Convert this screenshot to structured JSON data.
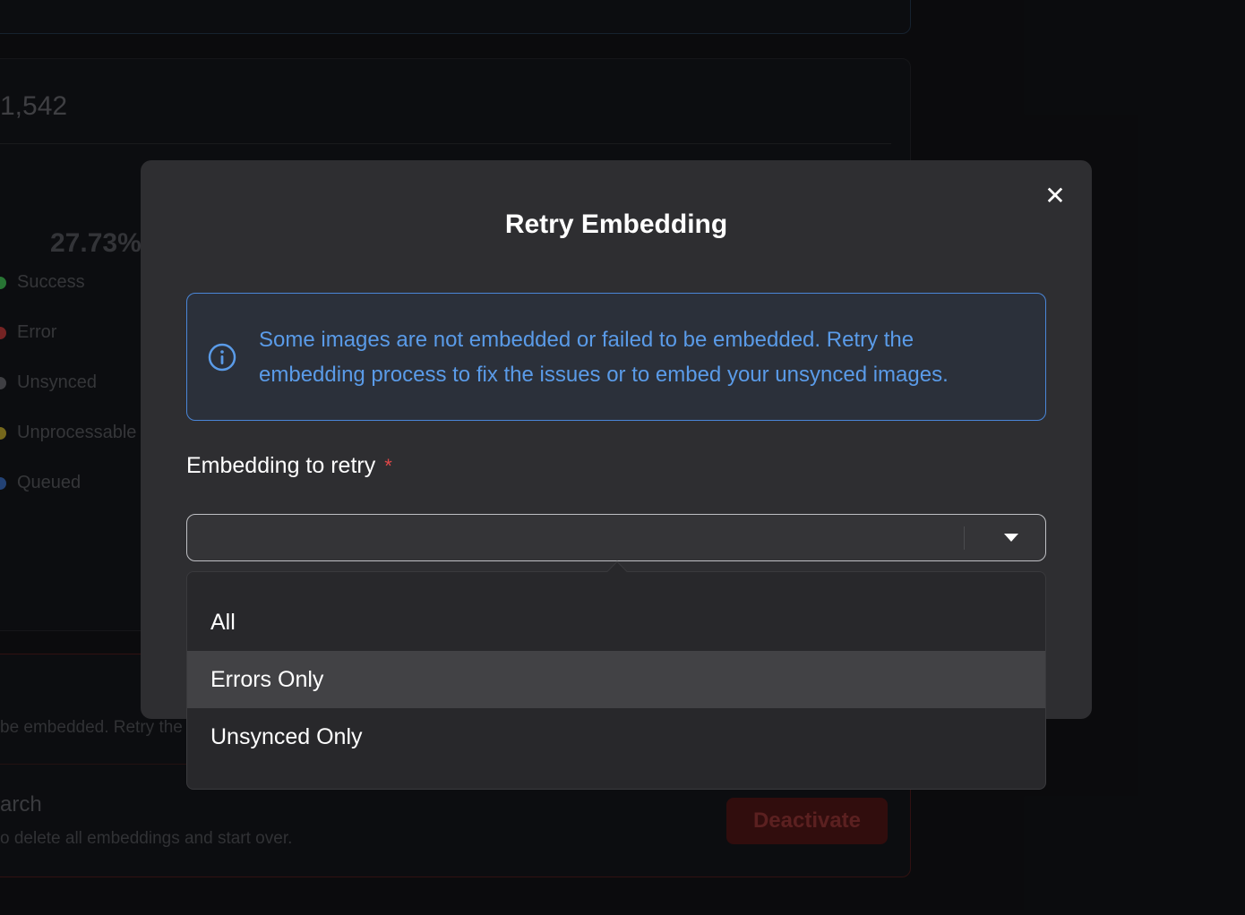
{
  "background": {
    "total_count": "1,542",
    "percent": "27.73%",
    "legend": [
      {
        "label": "Success",
        "color": "#2f8a3e"
      },
      {
        "label": "Error",
        "color": "#8a2a2a"
      },
      {
        "label": "Unsynced",
        "color": "#4a4b4f"
      },
      {
        "label": "Unprocessable",
        "color": "#8a7a22"
      },
      {
        "label": "Queued",
        "color": "#2a4e8a"
      }
    ],
    "danger_desc": "be embedded. Retry the",
    "danger_title": "arch",
    "danger_sub": "o delete all embeddings and start over.",
    "deactivate_label": "Deactivate"
  },
  "modal": {
    "title": "Retry Embedding",
    "close_glyph": "✕",
    "info_text": "Some images are not embedded or failed to be embedded. Retry the embedding process to fix the issues or to embed your unsynced images.",
    "field_label": "Embedding to retry",
    "required_mark": "*",
    "select_value": "",
    "options": [
      "All",
      "Errors Only",
      "Unsynced Only"
    ],
    "hovered_option": "Errors Only"
  }
}
